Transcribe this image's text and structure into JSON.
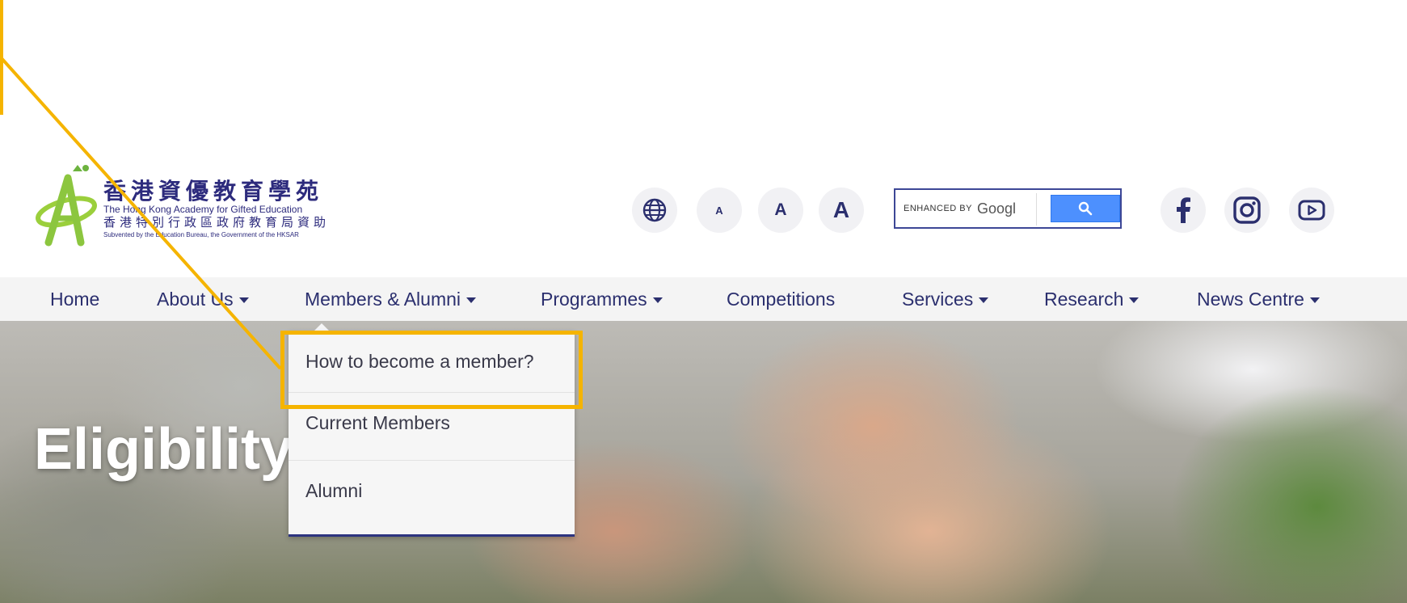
{
  "logo": {
    "cn_name": "香港資優教育學苑",
    "en_name": "The Hong Kong Academy for Gifted Education",
    "cn_sub": "香港特別行政區政府教育局資助",
    "en_sub": "Subvented by the Education Bureau, the Government of the HKSAR"
  },
  "tools": {
    "language_icon": "globe-icon",
    "font_small": "A",
    "font_medium": "A",
    "font_large": "A"
  },
  "search": {
    "enhanced_by": "ENHANCED BY",
    "brand": "Googl",
    "button_icon": "search-icon"
  },
  "social": [
    "facebook-icon",
    "instagram-icon",
    "youtube-icon"
  ],
  "nav": {
    "items": [
      {
        "label": "Home",
        "has_dropdown": false
      },
      {
        "label": "About Us",
        "has_dropdown": true
      },
      {
        "label": "Members & Alumni",
        "has_dropdown": true
      },
      {
        "label": "Programmes",
        "has_dropdown": true
      },
      {
        "label": "Competitions",
        "has_dropdown": false
      },
      {
        "label": "Services",
        "has_dropdown": true
      },
      {
        "label": "Research",
        "has_dropdown": true
      },
      {
        "label": "News Centre",
        "has_dropdown": true
      }
    ]
  },
  "dropdown": {
    "items": [
      "How to become a member?",
      "Current Members",
      "Alumni"
    ],
    "highlighted_index": 0
  },
  "hero": {
    "title": "Eligibility"
  },
  "colors": {
    "brand_navy": "#2b2f6e",
    "highlight": "#f5b400",
    "search_blue": "#4d90fe",
    "nav_bg": "#f4f4f4"
  }
}
